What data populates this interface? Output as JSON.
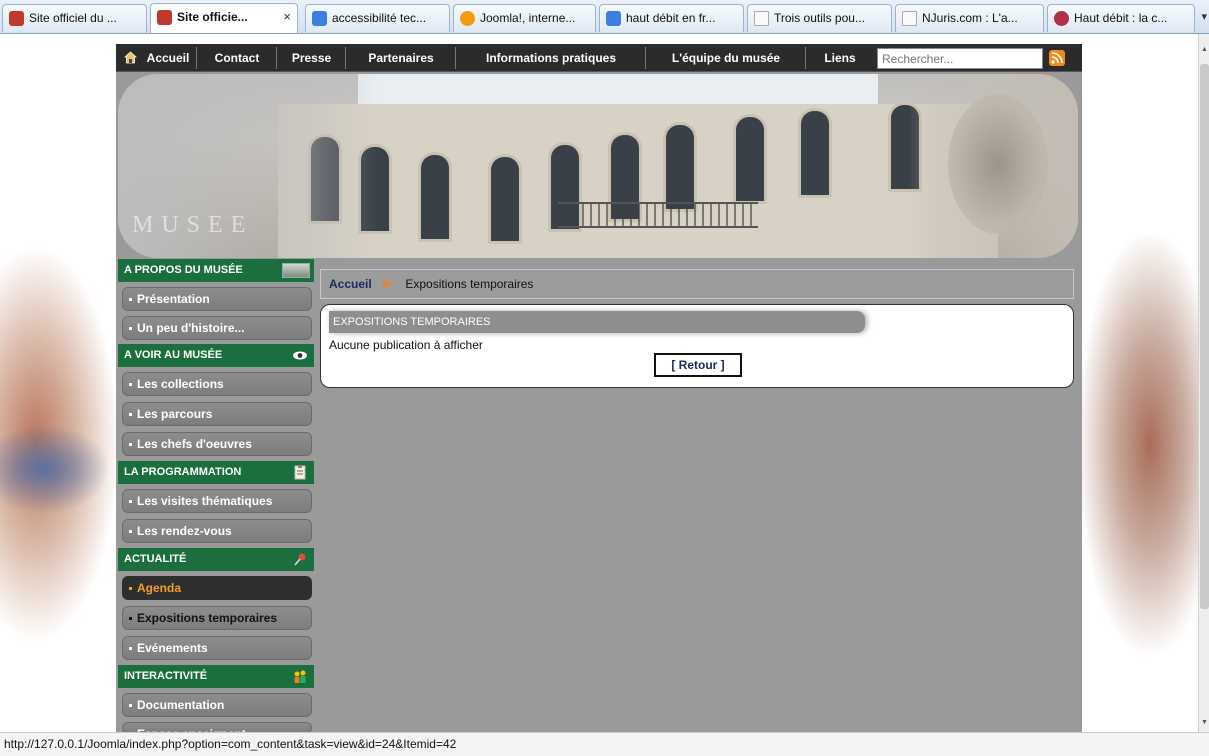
{
  "browser": {
    "tabs": [
      {
        "title": "Site officiel du ...",
        "active": false,
        "icon": "shield-icon",
        "icon_color": "#c0392b"
      },
      {
        "title": "Site officie...",
        "active": true,
        "icon": "shield-icon",
        "icon_color": "#c0392b",
        "close": "×"
      },
      {
        "title": "accessibilité tec...",
        "active": false,
        "icon": "google-icon",
        "icon_color": "#3d7fe0"
      },
      {
        "title": "Joomla!, interne...",
        "active": false,
        "icon": "joomla-icon",
        "icon_color": "#f39c12"
      },
      {
        "title": "haut débit en fr...",
        "active": false,
        "icon": "google-icon",
        "icon_color": "#3d7fe0"
      },
      {
        "title": "Trois outils pou...",
        "active": false,
        "icon": "page-icon",
        "icon_color": "#dcdcdc"
      },
      {
        "title": "NJuris.com : L'a...",
        "active": false,
        "icon": "page-icon",
        "icon_color": "#dcdcdc"
      },
      {
        "title": "Haut débit : la c...",
        "active": false,
        "icon": "zdnet-icon",
        "icon_color": "#b0304a"
      }
    ],
    "tab_overflow": "▾",
    "status_url": "http://127.0.0.1/Joomla/index.php?option=com_content&task=view&id=24&Itemid=42"
  },
  "site": {
    "top_menu": [
      "Accueil",
      "Contact",
      "Presse",
      "Partenaires",
      "Informations pratiques",
      "L'équipe du musée",
      "Liens"
    ],
    "search_placeholder": "Rechercher...",
    "banner_text": "MUSEE",
    "colors": {
      "section_green": "#1b6e3e",
      "menu_bg": "#2b2b2b",
      "active_orange": "#f1a12a",
      "body_gray": "#9a9a9a"
    }
  },
  "sidebar": {
    "sections": [
      {
        "title": "A PROPOS DU MUSÉE",
        "icon": "building-icon",
        "items": [
          "Présentation",
          "Un peu d'histoire..."
        ]
      },
      {
        "title": "A VOIR AU MUSÉE",
        "icon": "eye-icon",
        "items": [
          "Les collections",
          "Les parcours",
          "Les chefs d'oeuvres"
        ]
      },
      {
        "title": "LA PROGRAMMATION",
        "icon": "clipboard-icon",
        "items": [
          "Les visites thématiques",
          "Les rendez-vous"
        ]
      },
      {
        "title": "ACTUALITÉ",
        "icon": "pin-icon",
        "items": [
          "Agenda",
          "Expositions temporaires",
          "Evénements"
        ]
      },
      {
        "title": "INTERACTIVITÉ",
        "icon": "people-icon",
        "items": [
          "Documentation",
          "Espace enseignant"
        ]
      }
    ],
    "active_item": "Agenda",
    "current_item": "Expositions temporaires"
  },
  "breadcrumb": {
    "home": "Accueil",
    "current": "Expositions temporaires"
  },
  "content": {
    "heading": "EXPOSITIONS TEMPORAIRES",
    "message": "Aucune publication à afficher",
    "back_button": "[ Retour ]"
  }
}
